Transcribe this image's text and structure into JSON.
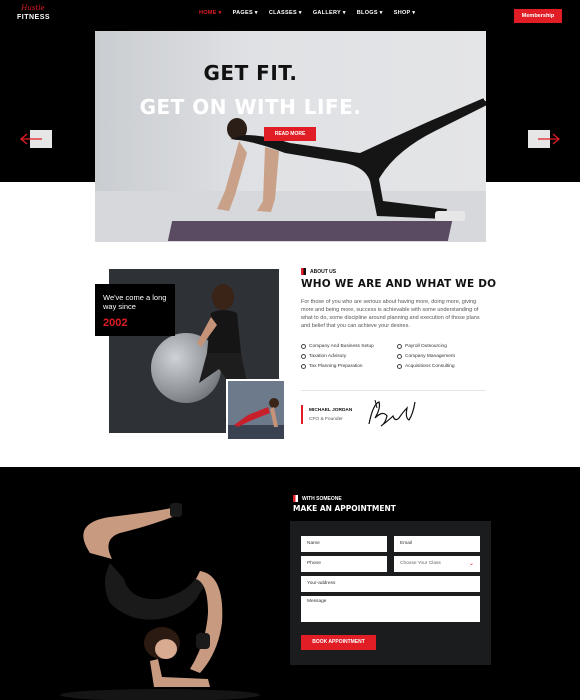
{
  "header": {
    "logo_script": "Hustle",
    "logo_word": "FITNESS",
    "nav": [
      {
        "label": "HOME ▾",
        "active": true
      },
      {
        "label": "PAGES ▾",
        "active": false
      },
      {
        "label": "CLASSES ▾",
        "active": false
      },
      {
        "label": "GALLERY ▾",
        "active": false
      },
      {
        "label": "BLOGS ▾",
        "active": false
      },
      {
        "label": "SHOP ▾",
        "active": false
      }
    ],
    "membership_label": "Membership"
  },
  "hero": {
    "line1": "GET FIT.",
    "line2": "GET ON WITH LIFE.",
    "cta_label": "READ MORE",
    "prev_icon": "arrow-left-icon",
    "next_icon": "arrow-right-icon"
  },
  "about": {
    "badge_line1": "We've come a long",
    "badge_line2": "way since",
    "badge_year": "2002",
    "tag": "ABOUT US",
    "title": "WHO WE ARE AND WHAT WE DO",
    "text": "For those of you who are serious about having more, doing more, giving more and being more, success is achievable with some understanding of what to do, some discipline around planning and execution of those plans and belief that you can achieve your desires.",
    "features": [
      "Company And Business Setup",
      "Payroll Outsourcing",
      "Taxation Advisory",
      "Company Management",
      "Tax Planning Preparation",
      "Acquisitions Consulting"
    ],
    "signer_name": "MICHAEL JORDAN",
    "signer_role": "CFO & Founder"
  },
  "appointment": {
    "tag": "WITH SOMEONE",
    "title": "MAKE AN APPOINTMENT",
    "fields": {
      "name": "Name",
      "email": "Email",
      "phone": "Phone",
      "class": "Choose Your Class",
      "address": "Your-address",
      "message": "Message"
    },
    "button_label": "BOOK APPOINTMENT"
  },
  "colors": {
    "accent": "#e11d26",
    "dark": "#000000",
    "form_bg": "#1b1c1e"
  }
}
